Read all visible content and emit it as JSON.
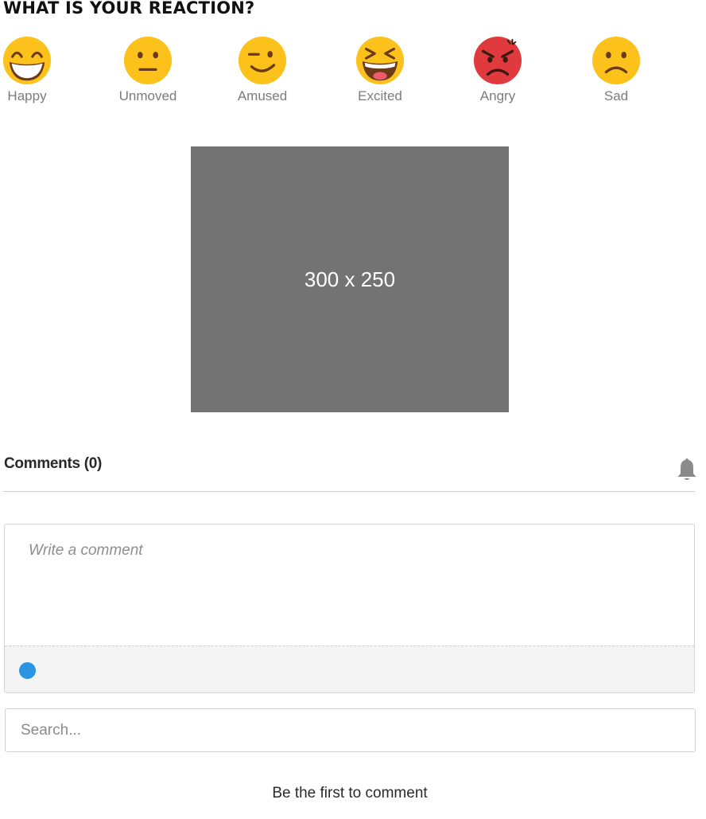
{
  "reactions_section": {
    "title": "WHAT IS YOUR REACTION?",
    "items": [
      {
        "label": "Happy",
        "icon": "grinning-face-icon"
      },
      {
        "label": "Unmoved",
        "icon": "neutral-face-icon"
      },
      {
        "label": "Amused",
        "icon": "winking-face-icon"
      },
      {
        "label": "Excited",
        "icon": "squinting-laughing-face-icon"
      },
      {
        "label": "Angry",
        "icon": "angry-face-icon"
      },
      {
        "label": "Sad",
        "icon": "frowning-face-icon"
      }
    ]
  },
  "ad": {
    "label": "300 x 250",
    "background": "#737373"
  },
  "comments": {
    "title": "Comments (0)",
    "bell_icon": "bell-icon",
    "write_placeholder": "Write a comment",
    "status_dot_color": "#2b94e3",
    "search_placeholder": "Search...",
    "empty_message": "Be the first to comment"
  },
  "colors": {
    "emoji_yellow": "#fcc21b",
    "emoji_red": "#e0393e",
    "emoji_feature": "#6b3a18"
  }
}
